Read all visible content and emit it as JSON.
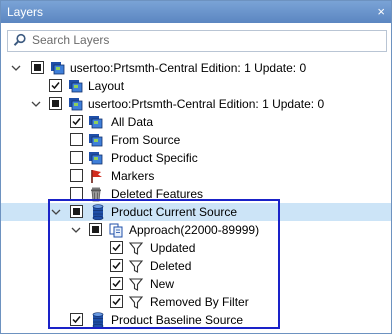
{
  "window": {
    "title": "Layers",
    "close_glyph": "×"
  },
  "search": {
    "placeholder": "Search Layers"
  },
  "tree": [
    {
      "label": "usertoo:Prtsmth-Central Edition: 1 Update: 0",
      "check": "partial",
      "expanded": true,
      "icon": "multi-layer-icon"
    },
    {
      "label": "Layout",
      "check": "checked",
      "icon": "multi-layer-icon"
    },
    {
      "label": "usertoo:Prtsmth-Central Edition: 1 Update: 0",
      "check": "partial",
      "expanded": true,
      "icon": "multi-layer-icon"
    },
    {
      "label": "All Data",
      "check": "checked",
      "icon": "multi-layer-icon"
    },
    {
      "label": "From Source",
      "check": "unchecked",
      "icon": "multi-layer-icon"
    },
    {
      "label": "Product Specific",
      "check": "unchecked",
      "icon": "multi-layer-icon"
    },
    {
      "label": "Markers",
      "check": "unchecked",
      "icon": "flag-icon"
    },
    {
      "label": "Deleted Features",
      "check": "unchecked",
      "icon": "trash-icon"
    },
    {
      "label": "Product Current Source",
      "check": "partial",
      "expanded": true,
      "icon": "database-icon",
      "selected": true
    },
    {
      "label": "Approach(22000-89999)",
      "check": "partial",
      "expanded": true,
      "icon": "copy-layer-icon"
    },
    {
      "label": "Updated",
      "check": "checked",
      "icon": "filter-icon"
    },
    {
      "label": "Deleted",
      "check": "checked",
      "icon": "filter-icon"
    },
    {
      "label": "New",
      "check": "checked",
      "icon": "filter-icon"
    },
    {
      "label": "Removed By Filter",
      "check": "checked",
      "icon": "filter-icon"
    },
    {
      "label": "Product Baseline Source",
      "check": "checked",
      "icon": "database-icon"
    }
  ]
}
